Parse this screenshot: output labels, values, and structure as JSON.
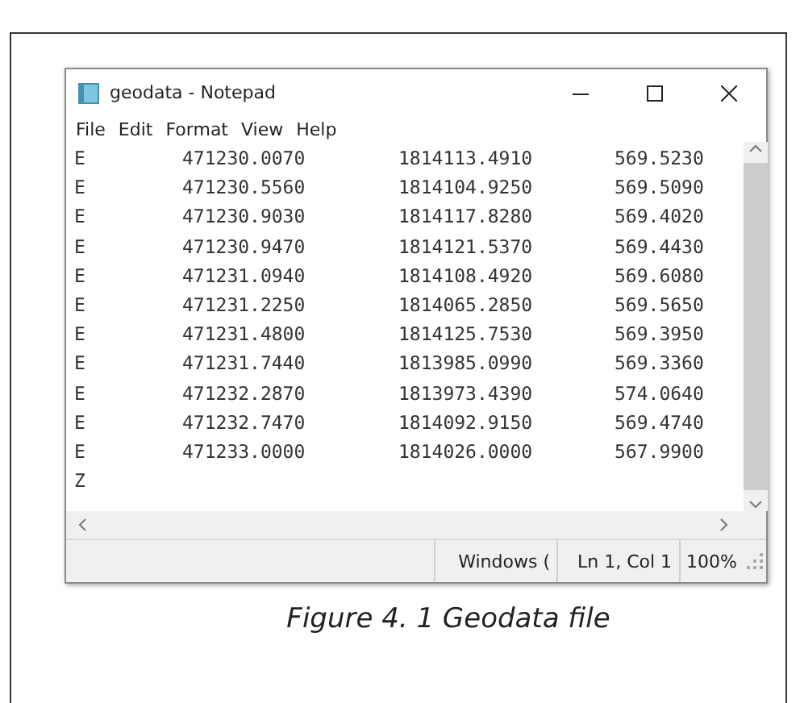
{
  "window": {
    "title": "geodata - Notepad"
  },
  "menu": [
    "File",
    "Edit",
    "Format",
    "View",
    "Help"
  ],
  "lines": [
    {
      "code": "E",
      "easting": "471230.0070",
      "northing": "1814113.4910",
      "elevation": "569.5230"
    },
    {
      "code": "E",
      "easting": "471230.5560",
      "northing": "1814104.9250",
      "elevation": "569.5090"
    },
    {
      "code": "E",
      "easting": "471230.9030",
      "northing": "1814117.8280",
      "elevation": "569.4020"
    },
    {
      "code": "E",
      "easting": "471230.9470",
      "northing": "1814121.5370",
      "elevation": "569.4430"
    },
    {
      "code": "E",
      "easting": "471231.0940",
      "northing": "1814108.4920",
      "elevation": "569.6080"
    },
    {
      "code": "E",
      "easting": "471231.2250",
      "northing": "1814065.2850",
      "elevation": "569.5650"
    },
    {
      "code": "E",
      "easting": "471231.4800",
      "northing": "1814125.7530",
      "elevation": "569.3950"
    },
    {
      "code": "E",
      "easting": "471231.7440",
      "northing": "1813985.0990",
      "elevation": "569.3360"
    },
    {
      "code": "E",
      "easting": "471232.2870",
      "northing": "1813973.4390",
      "elevation": "574.0640"
    },
    {
      "code": "E",
      "easting": "471232.7470",
      "northing": "1814092.9150",
      "elevation": "569.4740"
    },
    {
      "code": "E",
      "easting": "471233.0000",
      "northing": "1814026.0000",
      "elevation": "567.9900"
    },
    {
      "code": "Z"
    }
  ],
  "status_bar": [
    "Windows (",
    "Ln 1, Col 1",
    "100%"
  ],
  "caption": "Figure 4. 1 Geodata file"
}
